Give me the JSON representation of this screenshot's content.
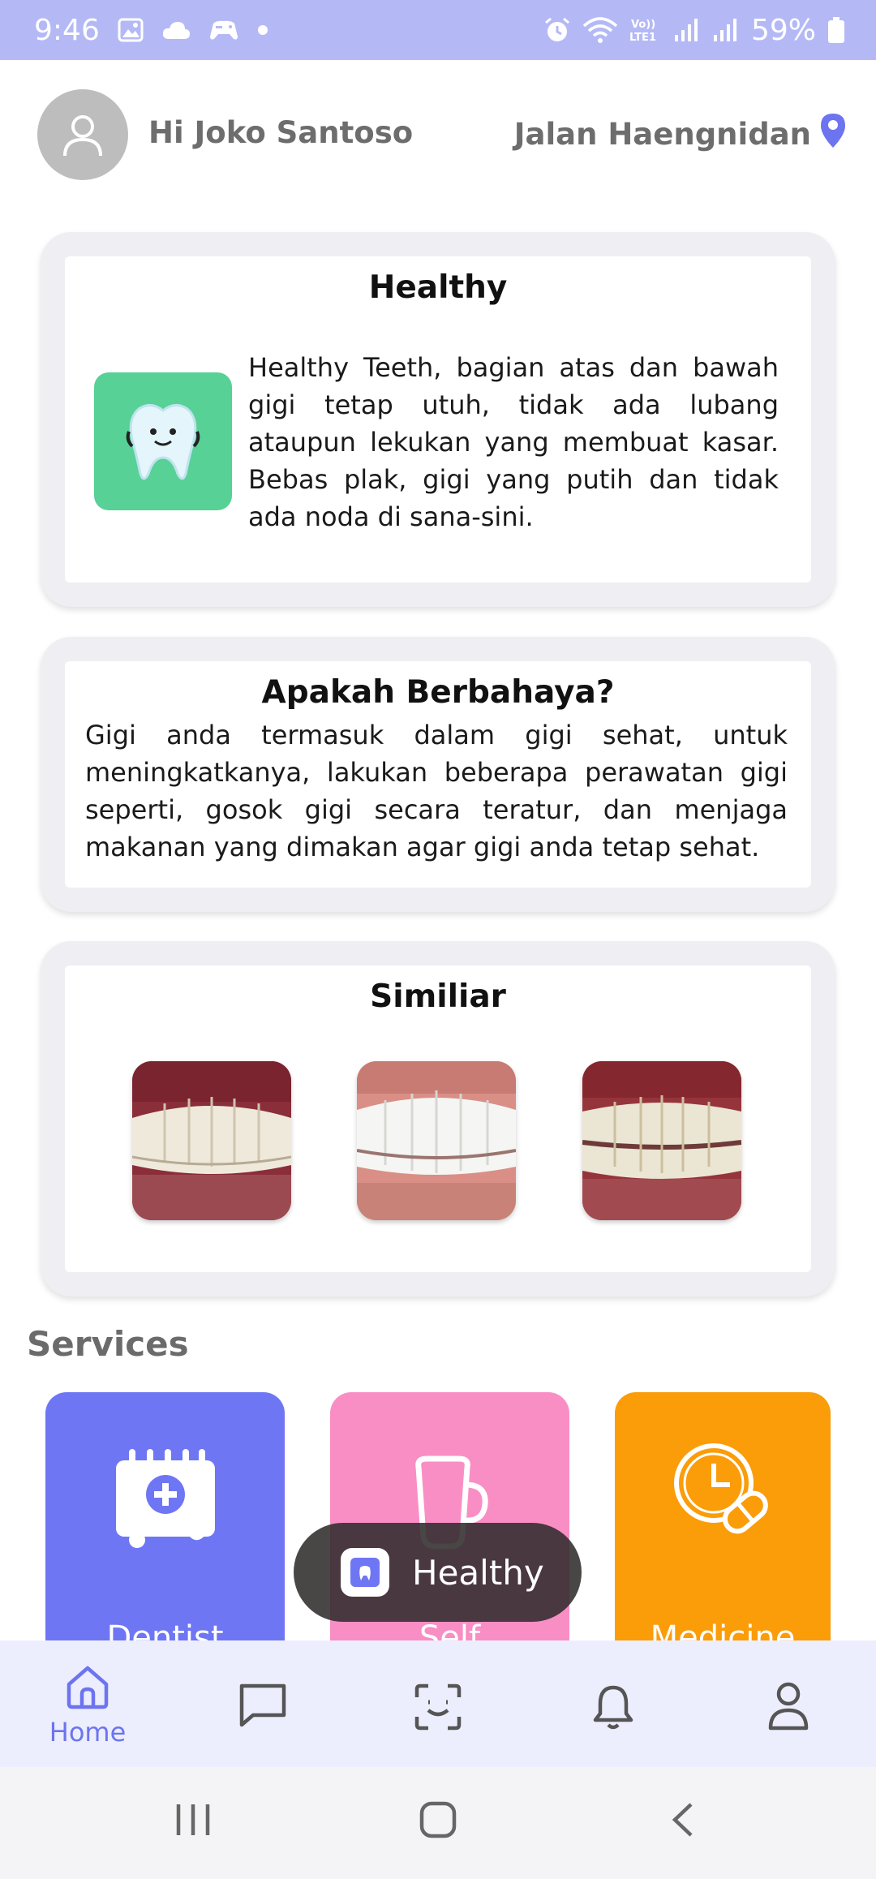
{
  "status_bar": {
    "time": "9:46",
    "battery": "59%",
    "icons": [
      "gallery-icon",
      "cloud-icon",
      "game-icon",
      "dot-icon",
      "alarm-icon",
      "wifi-icon",
      "volte-icon",
      "signal-icon",
      "signal-icon",
      "battery-icon"
    ]
  },
  "header": {
    "greeting": "Hi Joko Santoso",
    "location": "Jalan Haengnidan",
    "location_icon": "map-pin-icon",
    "avatar_icon": "user-avatar-icon"
  },
  "card_healthy": {
    "title": "Healthy",
    "icon": "tooth-icon",
    "description": "Healthy Teeth, bagian atas dan bawah gigi tetap utuh, tidak ada lubang ataupun lekukan yang membuat kasar. Bebas plak, gigi yang putih dan tidak ada noda di sana-sini."
  },
  "card_danger": {
    "title": "Apakah Berbahaya?",
    "description": "Gigi anda termasuk dalam gigi sehat, untuk meningkatkanya, lakukan beberapa perawatan gigi seperti, gosok gigi secara teratur, dan menjaga makanan yang dimakan agar gigi anda tetap sehat."
  },
  "card_similar": {
    "title": "Similiar",
    "images": [
      "teeth-photo-1",
      "teeth-photo-2",
      "teeth-photo-3"
    ]
  },
  "services": {
    "title": "Services",
    "items": [
      {
        "label": "Dentist",
        "icon": "dentist-calendar-icon",
        "color": "#6e76f4"
      },
      {
        "label": "Self",
        "icon": "mug-icon",
        "color": "#f98ec5"
      },
      {
        "label": "Medicine",
        "icon": "medicine-clock-icon",
        "color": "#fb9c09"
      }
    ]
  },
  "toast": {
    "text": "Healthy",
    "icon": "app-icon"
  },
  "bottom_nav": {
    "accent": "#6c74ef",
    "items": [
      {
        "label": "Home",
        "icon": "home-icon",
        "active": true
      },
      {
        "label": "",
        "icon": "chat-icon",
        "active": false
      },
      {
        "label": "",
        "icon": "scan-face-icon",
        "active": false
      },
      {
        "label": "",
        "icon": "bell-icon",
        "active": false
      },
      {
        "label": "",
        "icon": "profile-icon",
        "active": false
      }
    ]
  },
  "system_nav": [
    "recents-icon",
    "home-circle-icon",
    "back-icon"
  ]
}
